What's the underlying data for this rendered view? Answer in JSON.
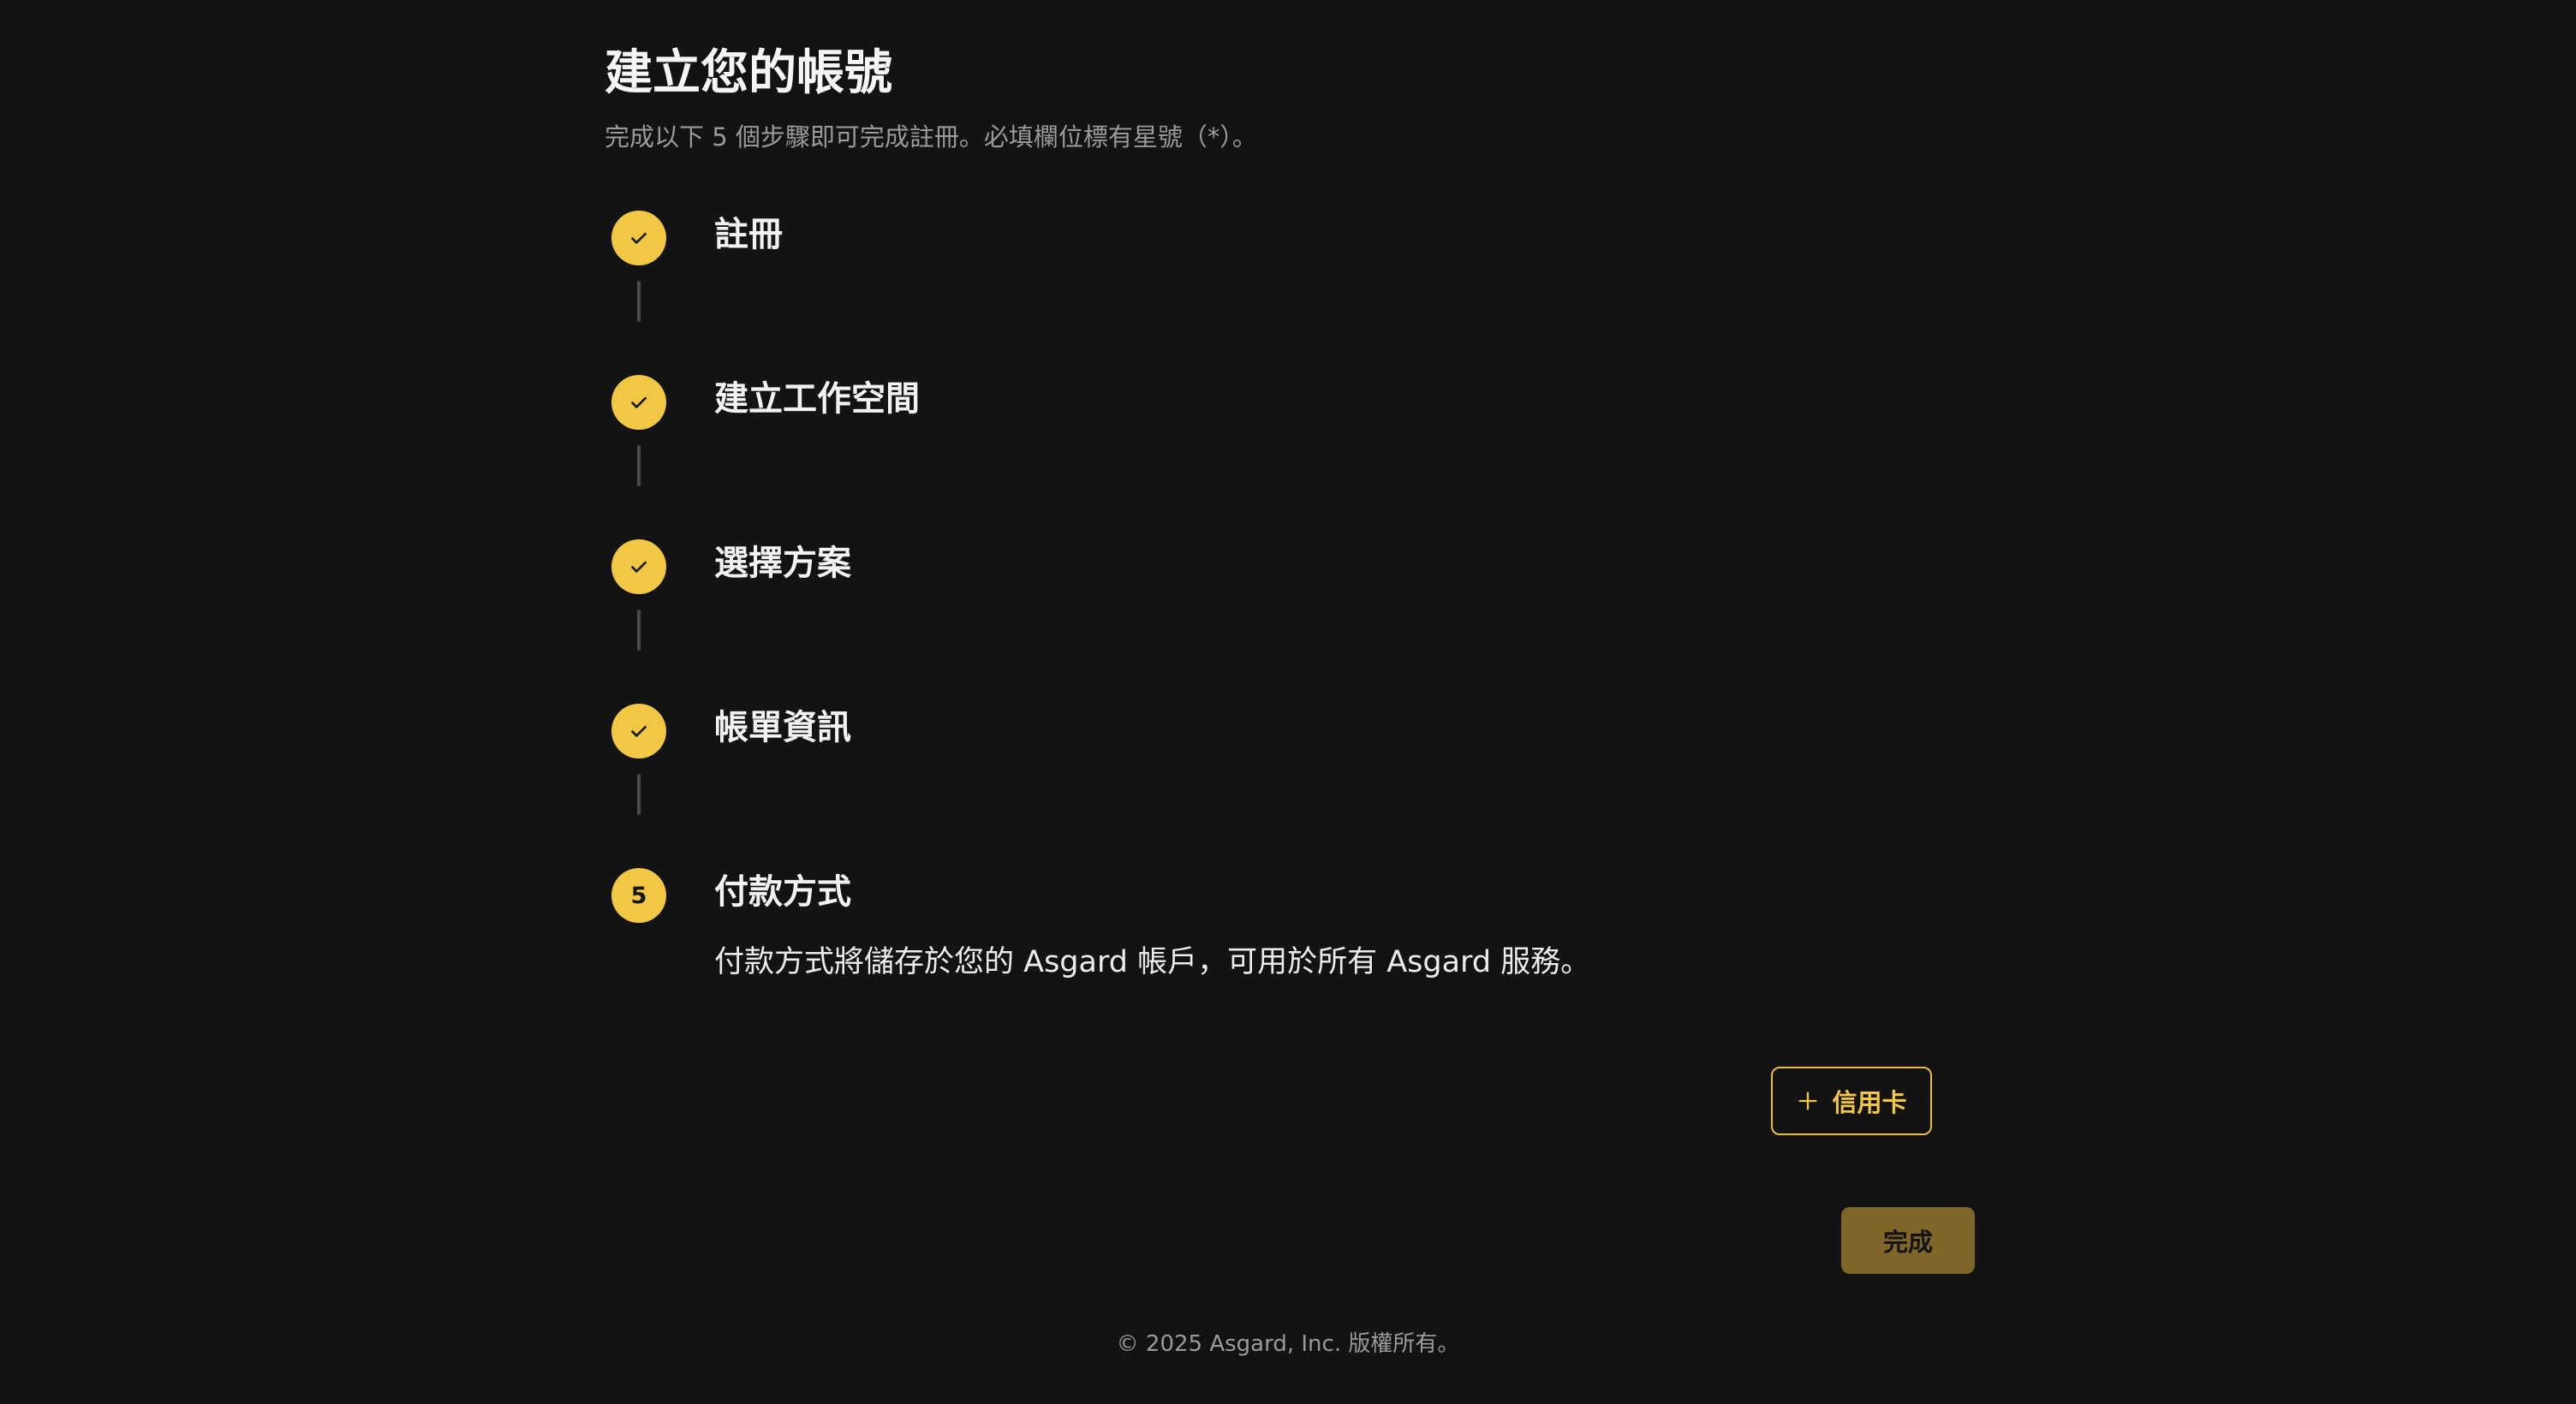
{
  "header": {
    "title": "建立您的帳號",
    "subtitle": "完成以下 5 個步驟即可完成註冊。必填欄位標有星號（*）。"
  },
  "steps": [
    {
      "label": "註冊",
      "status": "completed",
      "icon": "check-icon"
    },
    {
      "label": "建立工作空間",
      "status": "completed",
      "icon": "check-icon"
    },
    {
      "label": "選擇方案",
      "status": "completed",
      "icon": "check-icon"
    },
    {
      "label": "帳單資訊",
      "status": "completed",
      "icon": "check-icon"
    },
    {
      "label": "付款方式",
      "status": "current",
      "number": "5",
      "description": "付款方式將儲存於您的 Asgard 帳戶，可用於所有 Asgard 服務。"
    }
  ],
  "actions": {
    "add_card_label": "信用卡",
    "add_card_icon": "plus-icon",
    "finish_label": "完成"
  },
  "footer": {
    "copyright": "© 2025 Asgard, Inc. 版權所有。"
  },
  "colors": {
    "background": "#131313",
    "accent": "#f2c744",
    "finish_button": "#7f6628",
    "muted_text": "#9a9a9a"
  }
}
